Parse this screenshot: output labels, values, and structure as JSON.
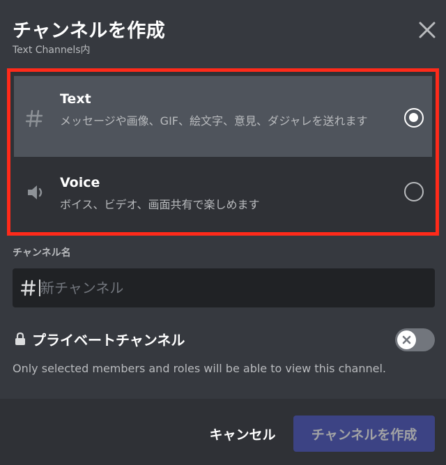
{
  "modal": {
    "title": "チャンネルを作成",
    "subtitle": "Text Channels内"
  },
  "channel_types": [
    {
      "icon": "hash-icon",
      "title": "Text",
      "description": "メッセージや画像、GIF、絵文字、意見、ダジャレを送れます",
      "selected": true
    },
    {
      "icon": "speaker-icon",
      "title": "Voice",
      "description": "ボイス、ビデオ、画面共有で楽しめます",
      "selected": false
    }
  ],
  "name_field": {
    "label": "チャンネル名",
    "placeholder": "新チャンネル",
    "value": ""
  },
  "private": {
    "label": "プライベートチャンネル",
    "enabled": false,
    "helper": "Only selected members and roles will be able to view this channel."
  },
  "footer": {
    "cancel_label": "キャンセル",
    "create_label": "チャンネルを作成"
  },
  "colors": {
    "background": "#36393f",
    "selected_option": "#4f545c",
    "highlight_border": "#ff2a1a",
    "primary_button": "#4752c4"
  }
}
